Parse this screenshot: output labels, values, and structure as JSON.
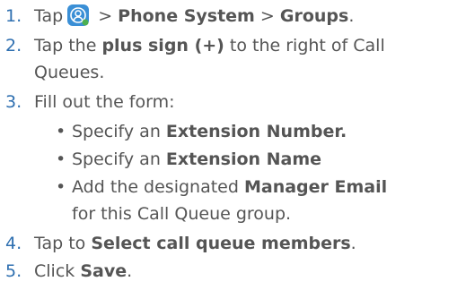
{
  "steps": [
    {
      "num": "1.",
      "pre": "Tap",
      "mid": " > ",
      "b1": "Phone System",
      "mid2": " > ",
      "b2": "Groups",
      "post": "."
    },
    {
      "num": "2.",
      "pre": "Tap the ",
      "b1": "plus sign (+)",
      "post": " to the right of Call",
      "cont": "Queues."
    },
    {
      "num": "3.",
      "text": "Fill out the form:"
    },
    {
      "num": "4.",
      "pre": "Tap to ",
      "b1": "Select call queue members",
      "post": "."
    },
    {
      "num": "5.",
      "pre": "Click ",
      "b1": "Save",
      "post": "."
    }
  ],
  "subitems": [
    {
      "pre": "Specify an ",
      "b1": "Extension Number."
    },
    {
      "pre": "Specify an ",
      "b1": "Extension Name"
    },
    {
      "pre": "Add the designated ",
      "b1": "Manager Email",
      "cont": "for this Call Queue group."
    }
  ],
  "bullet": "•",
  "icon": {
    "name": "users-app-icon",
    "color": "#3a8fd6"
  }
}
